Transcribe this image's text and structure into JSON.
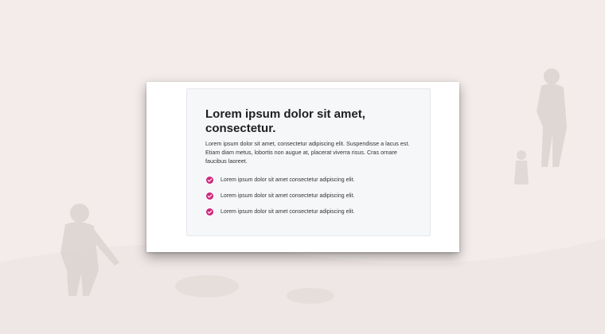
{
  "background": {
    "color": "#f3ecea",
    "silhouette_color": "#d8d0cd"
  },
  "card": {
    "title": "Lorem ipsum dolor sit amet, consectetur.",
    "body": "Lorem ipsum dolor sit amet, consectetur adipiscing elit. Suspendisse a lacus est. Etiam diam metus, lobortis non augue at, placerat viverra risus. Cras ornare faucibus laoreet.",
    "features": [
      {
        "icon": "check-circle-icon",
        "text": "Lorem ipsum dolor sit amet consectetur adipiscing elit."
      },
      {
        "icon": "check-circle-icon",
        "text": "Lorem ipsum dolor sit amet consectetur adipiscing elit."
      },
      {
        "icon": "check-circle-icon",
        "text": "Lorem ipsum dolor sit amet consectetur adipiscing elit."
      }
    ]
  },
  "colors": {
    "accent": "#d0267c",
    "title": "#1f1f1f",
    "text": "#333333"
  }
}
